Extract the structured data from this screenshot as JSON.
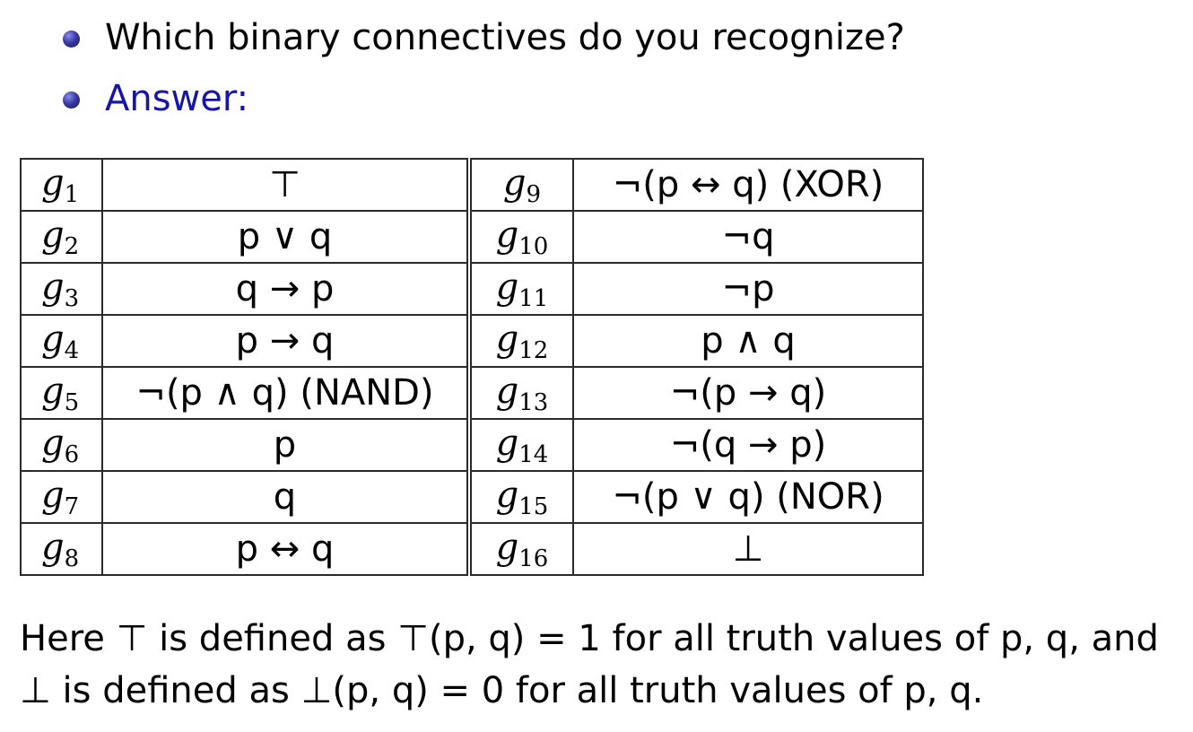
{
  "question": "Which binary connectives do you recognize?",
  "answer_label": "Answer:",
  "table": {
    "rows": [
      {
        "left_name": "g",
        "left_index": "1",
        "left_formula": "⊤",
        "right_name": "g",
        "right_index": "9",
        "right_formula": "¬(p ↔ q) (XOR)"
      },
      {
        "left_name": "g",
        "left_index": "2",
        "left_formula": "p ∨ q",
        "right_name": "g",
        "right_index": "10",
        "right_formula": "¬q"
      },
      {
        "left_name": "g",
        "left_index": "3",
        "left_formula": "q → p",
        "right_name": "g",
        "right_index": "11",
        "right_formula": "¬p"
      },
      {
        "left_name": "g",
        "left_index": "4",
        "left_formula": "p → q",
        "right_name": "g",
        "right_index": "12",
        "right_formula": "p ∧ q"
      },
      {
        "left_name": "g",
        "left_index": "5",
        "left_formula": "¬(p ∧ q) (NAND)",
        "right_name": "g",
        "right_index": "13",
        "right_formula": "¬(p → q)"
      },
      {
        "left_name": "g",
        "left_index": "6",
        "left_formula": "p",
        "right_name": "g",
        "right_index": "14",
        "right_formula": "¬(q → p)"
      },
      {
        "left_name": "g",
        "left_index": "7",
        "left_formula": "q",
        "right_name": "g",
        "right_index": "15",
        "right_formula": "¬(p ∨ q) (NOR)"
      },
      {
        "left_name": "g",
        "left_index": "8",
        "left_formula": "p ↔ q",
        "right_name": "g",
        "right_index": "16",
        "right_formula": "⊥"
      }
    ]
  },
  "footnote": {
    "line1": "Here ⊤ is defined as ⊤(p, q) = 1 for all truth values of p, q, and",
    "line2": "⊥ is defined as ⊥(p, q) = 0 for all truth values of p, q."
  },
  "colors": {
    "answer_text": "#1515a8",
    "bullet": "#3a3aa8"
  }
}
